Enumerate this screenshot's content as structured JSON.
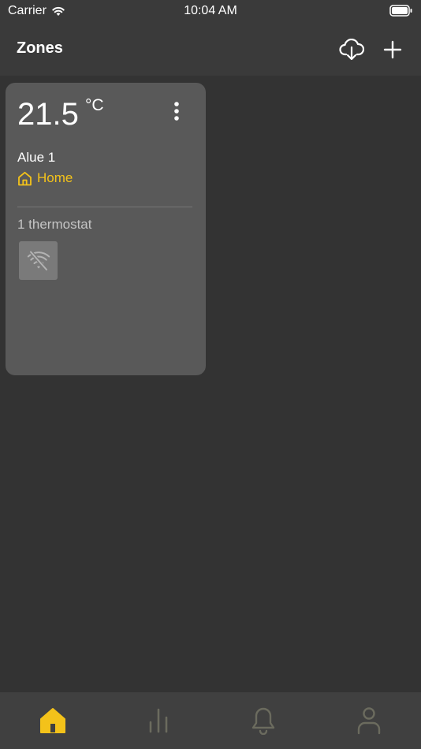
{
  "status_bar": {
    "carrier": "Carrier",
    "time": "10:04 AM",
    "wifi_icon": "wifi-icon",
    "battery_icon": "battery-icon"
  },
  "header": {
    "title": "Zones",
    "cloud_icon": "cloud-download-icon",
    "add_icon": "plus-icon"
  },
  "zones": [
    {
      "temperature": "21.5",
      "unit": "°C",
      "name": "Alue 1",
      "home_label": "Home",
      "thermostat_count": "1 thermostat",
      "device_status_icon": "wifi-off-icon"
    }
  ],
  "tabs": [
    {
      "icon": "home-icon",
      "active": true
    },
    {
      "icon": "bar-chart-icon",
      "active": false
    },
    {
      "icon": "bell-icon",
      "active": false
    },
    {
      "icon": "user-icon",
      "active": false
    }
  ],
  "colors": {
    "accent": "#f3c21a",
    "background": "#333333",
    "card": "#595959",
    "bar": "#3a3a3a",
    "tab_inactive": "#6b6b5e"
  }
}
